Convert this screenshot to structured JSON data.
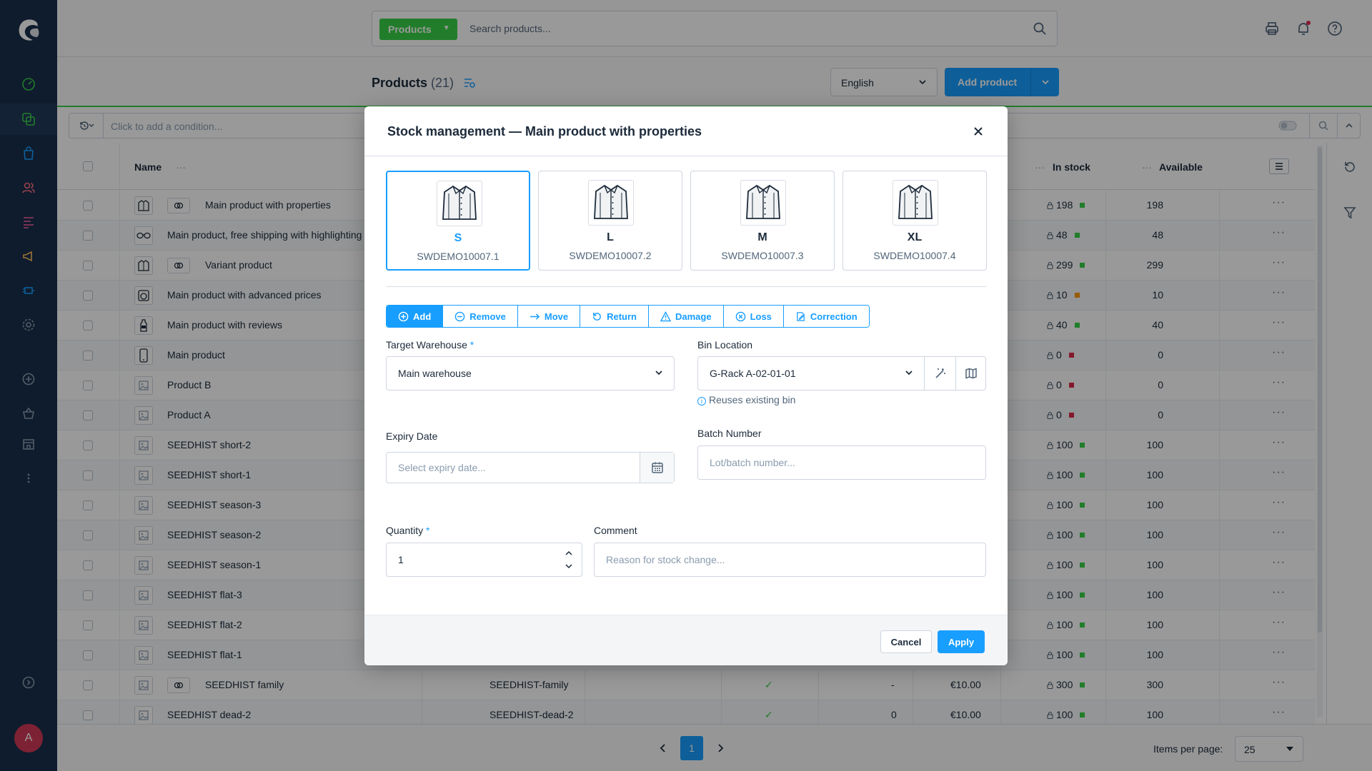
{
  "app": {
    "avatar_initial": "A",
    "brand_color": "#189eff",
    "entity_color": "#37d046"
  },
  "search": {
    "entity_label": "Products",
    "placeholder": "Search products..."
  },
  "header": {
    "title": "Products",
    "count": "(21)",
    "language": "English",
    "add_product_label": "Add product"
  },
  "filter": {
    "placeholder": "Click to add a condition..."
  },
  "table": {
    "columns": {
      "name": "Name",
      "in_stock": "In stock",
      "available": "Available"
    },
    "rows": [
      {
        "name": "Main product with properties",
        "variant": true,
        "icon": "shirt-icon",
        "stock": "198",
        "status": "#37d046",
        "available": "198"
      },
      {
        "name": "Main product, free shipping with highlighting",
        "variant": false,
        "icon": "sunglasses-icon",
        "stock": "48",
        "status": "#37d046",
        "available": "48"
      },
      {
        "name": "Variant product",
        "variant": true,
        "icon": "shirt-icon",
        "stock": "299",
        "status": "#37d046",
        "available": "299"
      },
      {
        "name": "Main product with advanced prices",
        "variant": false,
        "icon": "camera-icon",
        "stock": "10",
        "status": "#ff9800",
        "available": "10"
      },
      {
        "name": "Main product with reviews",
        "variant": false,
        "icon": "bottle-icon",
        "stock": "40",
        "status": "#37d046",
        "available": "40"
      },
      {
        "name": "Main product",
        "variant": false,
        "icon": "phone-icon",
        "stock": "0",
        "status": "#de294c",
        "available": "0"
      },
      {
        "name": "Product B",
        "variant": false,
        "icon": "image-icon",
        "stock": "0",
        "status": "#de294c",
        "available": "0"
      },
      {
        "name": "Product A",
        "variant": false,
        "icon": "image-icon",
        "stock": "0",
        "status": "#de294c",
        "available": "0"
      },
      {
        "name": "SEEDHIST short-2",
        "variant": false,
        "icon": "image-icon",
        "stock": "100",
        "status": "#37d046",
        "available": "100"
      },
      {
        "name": "SEEDHIST short-1",
        "variant": false,
        "icon": "image-icon",
        "stock": "100",
        "status": "#37d046",
        "available": "100"
      },
      {
        "name": "SEEDHIST season-3",
        "variant": false,
        "icon": "image-icon",
        "stock": "100",
        "status": "#37d046",
        "available": "100"
      },
      {
        "name": "SEEDHIST season-2",
        "variant": false,
        "icon": "image-icon",
        "stock": "100",
        "status": "#37d046",
        "available": "100"
      },
      {
        "name": "SEEDHIST season-1",
        "variant": false,
        "icon": "image-icon",
        "stock": "100",
        "status": "#37d046",
        "available": "100"
      },
      {
        "name": "SEEDHIST flat-3",
        "variant": false,
        "icon": "image-icon",
        "stock": "100",
        "status": "#37d046",
        "available": "100"
      },
      {
        "name": "SEEDHIST flat-2",
        "variant": false,
        "icon": "image-icon",
        "stock": "100",
        "status": "#37d046",
        "available": "100"
      },
      {
        "name": "SEEDHIST flat-1",
        "variant": false,
        "icon": "image-icon",
        "stock": "100",
        "status": "#37d046",
        "available": "100"
      },
      {
        "name": "SEEDHIST family",
        "variant": true,
        "icon": "image-icon",
        "number": "SEEDHIST-family",
        "active": "✓",
        "stock_col": "-",
        "price": "€10.00",
        "stock": "300",
        "status": "#37d046",
        "available": "300"
      },
      {
        "name": "SEEDHIST dead-2",
        "variant": false,
        "icon": "image-icon",
        "number": "SEEDHIST-dead-2",
        "active": "✓",
        "stock_col": "0",
        "price": "€10.00",
        "stock": "100",
        "status": "#37d046",
        "available": "100"
      }
    ]
  },
  "footer": {
    "page": "1",
    "items_per_page_label": "Items per page:",
    "items_per_page": "25"
  },
  "modal": {
    "title": "Stock management — Main product with properties",
    "variants": [
      {
        "size": "S",
        "sku": "SWDEMO10007.1",
        "selected": true
      },
      {
        "size": "L",
        "sku": "SWDEMO10007.2",
        "selected": false
      },
      {
        "size": "M",
        "sku": "SWDEMO10007.3",
        "selected": false
      },
      {
        "size": "XL",
        "sku": "SWDEMO10007.4",
        "selected": false
      }
    ],
    "actions": [
      "Add",
      "Remove",
      "Move",
      "Return",
      "Damage",
      "Loss",
      "Correction"
    ],
    "target_warehouse_label": "Target Warehouse",
    "target_warehouse_value": "Main warehouse",
    "bin_location_label": "Bin Location",
    "bin_location_value": "G-Rack A-02-01-01",
    "bin_hint": "Reuses existing bin",
    "expiry_label": "Expiry Date",
    "expiry_placeholder": "Select expiry date...",
    "batch_label": "Batch Number",
    "batch_placeholder": "Lot/batch number...",
    "quantity_label": "Quantity",
    "quantity_value": "1",
    "comment_label": "Comment",
    "comment_placeholder": "Reason for stock change...",
    "cancel_label": "Cancel",
    "apply_label": "Apply"
  }
}
